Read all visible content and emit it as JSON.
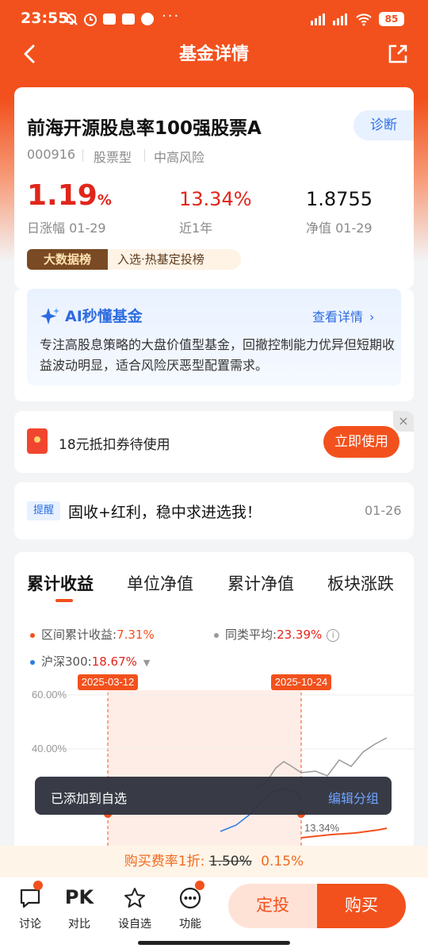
{
  "status_bar": {
    "time": "23:55",
    "dots": "···",
    "battery": "85"
  },
  "nav": {
    "title": "基金详情"
  },
  "fund": {
    "name": "前海开源股息率100强股票A",
    "diagnose": "诊断",
    "code": "000916",
    "type": "股票型",
    "risk": "中高风险",
    "daily_change": "1.19",
    "daily_change_unit": "%",
    "daily_label": "日涨幅 01-29",
    "one_year": "13.34%",
    "one_year_label": "近1年",
    "nav_value": "1.8755",
    "nav_label": "净值 01-29",
    "badge_dark": "大数据榜",
    "badge_light": "入选·热基定投榜"
  },
  "ai": {
    "title": "AI秒懂基金",
    "link": "查看详情",
    "text": "专注高股息策略的大盘价值型基金，回撤控制能力优异但短期收益波动明显，适合风险厌恶型配置需求。"
  },
  "coupon": {
    "text": "18元抵扣券待使用",
    "button": "立即使用",
    "close": "×"
  },
  "reminder": {
    "tag": "提醒",
    "text": "固收+红利，稳中求进选我！",
    "date": "01-26"
  },
  "tabs": [
    "累计收益",
    "单位净值",
    "累计净值",
    "板块涨跌"
  ],
  "legend": {
    "fund_label": "区间累计收益:",
    "fund_value": "7.31%",
    "peer_label": "同类平均:",
    "peer_value": "23.39%",
    "index_label": "沪深300:",
    "index_value": "18.67%"
  },
  "colors": {
    "fund": "#f2511d",
    "peer": "#999999",
    "index": "#2d7be5"
  },
  "chart_data": {
    "type": "line",
    "marker_dates": [
      "2025-03-12",
      "2025-10-24"
    ],
    "y_ticks": [
      "60.00%",
      "40.00%"
    ],
    "end_label": "13.34%",
    "series": [
      {
        "name": "区间累计收益",
        "color": "#f2511d",
        "values": []
      },
      {
        "name": "同类平均",
        "color": "#999999",
        "values": []
      },
      {
        "name": "沪深300",
        "color": "#2d7be5",
        "values": []
      }
    ]
  },
  "toast": {
    "message": "已添加到自选",
    "action": "编辑分组"
  },
  "fee": {
    "prefix": "购买费率1折:",
    "old": "1.50%",
    "new": "0.15%"
  },
  "bottom_bar": {
    "discuss": "讨论",
    "pk_icon": "PK",
    "pk": "对比",
    "watch": "设自选",
    "functions": "功能",
    "invest": "定投",
    "buy": "购买"
  }
}
